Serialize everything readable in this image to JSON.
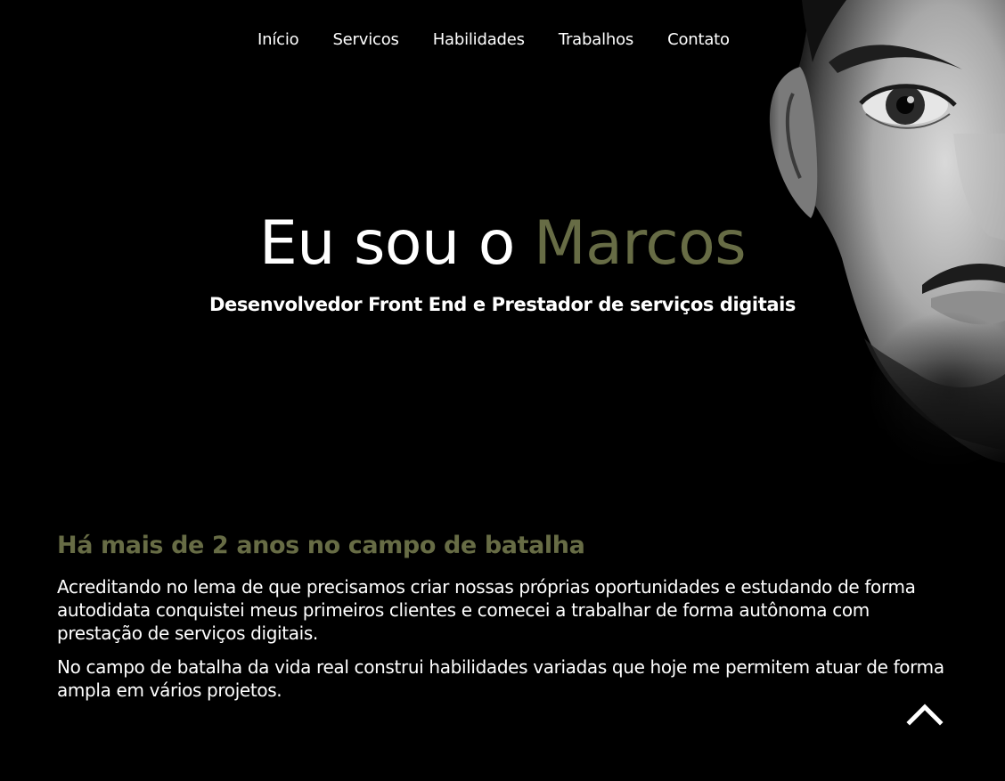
{
  "nav": {
    "items": [
      {
        "label": "Início"
      },
      {
        "label": "Servicos"
      },
      {
        "label": "Habilidades"
      },
      {
        "label": "Trabalhos"
      },
      {
        "label": "Contato"
      }
    ]
  },
  "hero": {
    "title_prefix": "Eu sou o ",
    "title_name": "Marcos",
    "subtitle": "Desenvolvedor Front End e Prestador de serviços digitais"
  },
  "about": {
    "heading": "Há mais de 2 anos no campo de batalha",
    "paragraphs": [
      "Acreditando no lema de que precisamos criar nossas próprias oportunidades e estudando de forma autodidata conquistei meus primeiros clientes e comecei a trabalhar de forma autônoma com prestação de serviços digitais.",
      "No campo de batalha da vida real construi habilidades variadas que hoje me permitem atuar de forma ampla em vários projetos."
    ]
  },
  "icons": {
    "back_to_top": "chevron-up-icon",
    "portrait": "portrait-photo"
  },
  "colors": {
    "background": "#000000",
    "accent": "#676c45",
    "text": "#ffffff"
  }
}
